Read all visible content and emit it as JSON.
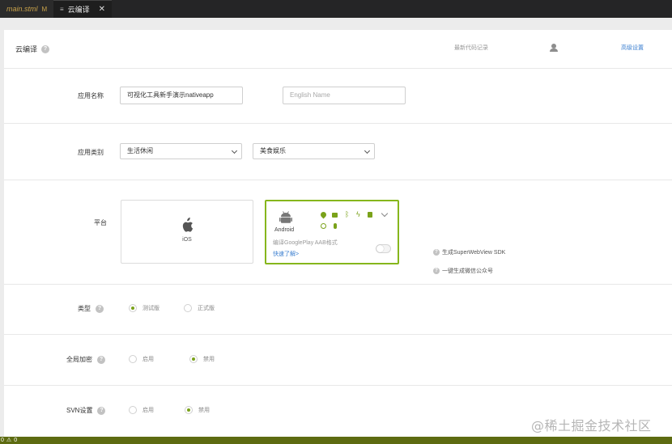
{
  "tabs": [
    {
      "label": "main.stml",
      "modifier": "M",
      "active": false
    },
    {
      "label": "云编译",
      "active": true,
      "close": "✕"
    }
  ],
  "header": {
    "title": "云编译",
    "record_link": "最新代码记录",
    "advanced_link": "高级设置"
  },
  "app_name": {
    "label": "应用名称",
    "value": "可视化工具新手演示nativeapp",
    "english_placeholder": "English Name"
  },
  "category": {
    "label": "应用类别",
    "primary": "生活休闲",
    "secondary": "美食娱乐"
  },
  "platform": {
    "label": "平台",
    "ios": {
      "name": "iOS"
    },
    "android": {
      "name": "Android",
      "desc": "编译GooglePlay AAB格式",
      "learn_more": "快速了解>",
      "toggle_on": false
    },
    "options": [
      "生成SuperWebView SDK",
      "一键生成微信公众号"
    ]
  },
  "type_row": {
    "label": "类型",
    "options": [
      "测试版",
      "正式版"
    ],
    "selected": 0
  },
  "encrypt_row": {
    "label": "全局加密",
    "options": [
      "启用",
      "禁用"
    ],
    "selected": 1
  },
  "svn_row": {
    "label": "SVN设置",
    "options": [
      "启用",
      "禁用"
    ],
    "selected": 1
  },
  "status": {
    "errors": "0",
    "warnings": "0"
  },
  "watermark": "@稀土掘金技术社区",
  "colors": {
    "accent_green": "#86b61c",
    "link_blue": "#3b7fd0",
    "status_bar": "#5d6b11"
  }
}
